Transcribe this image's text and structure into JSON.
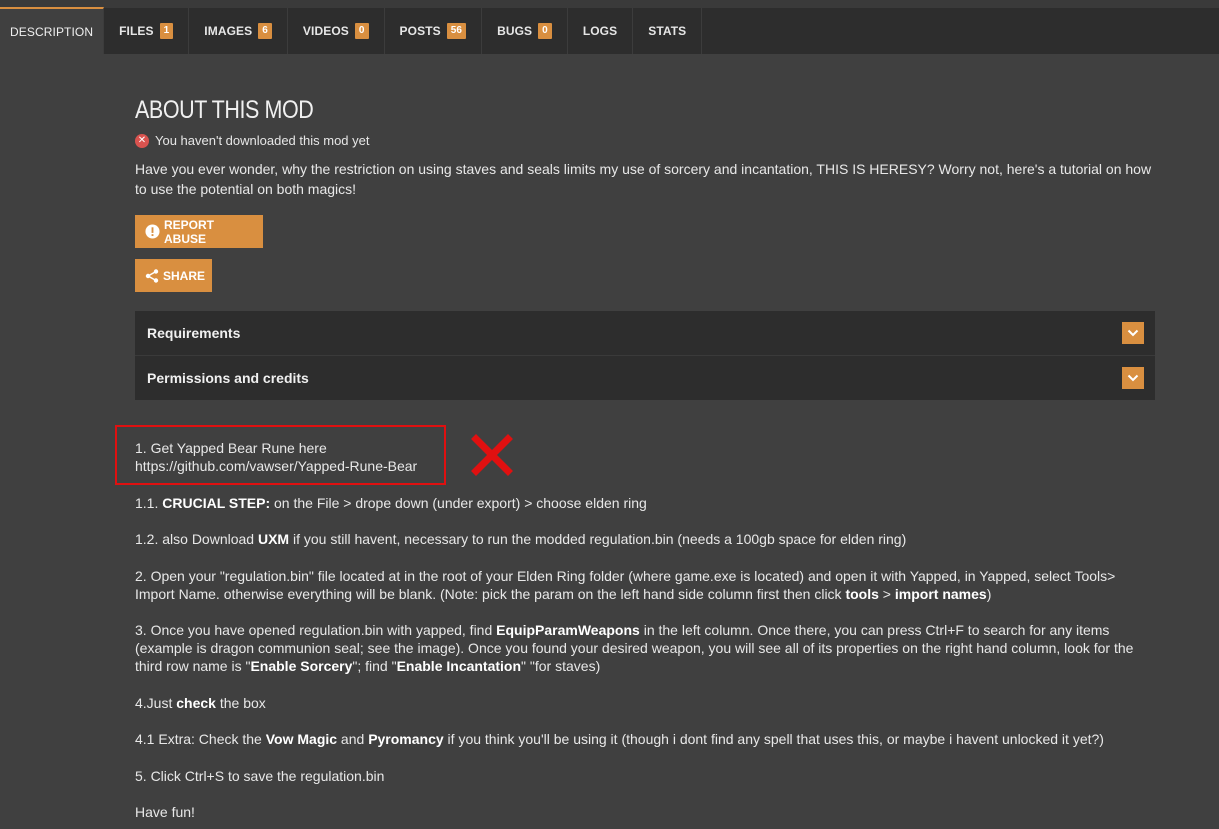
{
  "tabs": [
    {
      "label": "DESCRIPTION",
      "count": null,
      "active": true
    },
    {
      "label": "FILES",
      "count": "1"
    },
    {
      "label": "IMAGES",
      "count": "6"
    },
    {
      "label": "VIDEOS",
      "count": "0"
    },
    {
      "label": "POSTS",
      "count": "56"
    },
    {
      "label": "BUGS",
      "count": "0"
    },
    {
      "label": "LOGS",
      "count": null
    },
    {
      "label": "STATS",
      "count": null
    }
  ],
  "about": {
    "title": "ABOUT THIS MOD",
    "download_status": "You haven't downloaded this mod yet",
    "intro": "Have you ever wonder, why the restriction on using staves and seals limits my use of sorcery and incantation, THIS IS HERESY? Worry not, here's a tutorial on how to use the potential on both magics!"
  },
  "buttons": {
    "report": "REPORT ABUSE",
    "share": "SHARE"
  },
  "accordion": {
    "requirements": "Requirements",
    "permissions": "Permissions and credits"
  },
  "steps": {
    "s1_line1": "1. Get Yapped Bear Rune here",
    "s1_line2": "https://github.com/vawser/Yapped-Rune-Bear",
    "s11_bold": "CRUCIAL STEP:",
    "s11_pre": "1.1. ",
    "s11_post": " on the File > drope down (under export) > choose elden ring",
    "s12_pre": "1.2. also Download ",
    "s12_bold": "UXM",
    "s12_post": " if you still havent, necessary to run the modded regulation.bin (needs a 100gb space for elden ring)",
    "s2_pre": "2. Open your \"regulation.bin\" file located at in the root of your Elden Ring folder (where game.exe is located) and open it with Yapped, in Yapped, select Tools> Import Name. otherwise everything will be blank. (Note: pick the param on the left hand side column first then click ",
    "s2_b1": "tools",
    "s2_mid": " > ",
    "s2_b2": "import names",
    "s2_post": ")",
    "s3_pre": "3. Once you have opened regulation.bin with yapped, find ",
    "s3_b1": "EquipParamWeapons",
    "s3_mid1": " in the left column. Once there, you can press Ctrl+F to search for any items (example is dragon communion seal; see the image). Once you found your desired weapon, you will see all of its properties on the right hand column, look for the third row name is \"",
    "s3_b2": "Enable Sorcery",
    "s3_mid2": "\"; find \"",
    "s3_b3": "Enable Incantation",
    "s3_post": "\" \"for staves)",
    "s4_pre": "4.Just ",
    "s4_bold": "check",
    "s4_post": " the box",
    "s41_pre": "4.1 Extra: Check the ",
    "s41_b1": "Vow Magic",
    "s41_mid": " and ",
    "s41_b2": "Pyromancy",
    "s41_post": " if you think you'll be using it (though i dont find any spell that uses this, or maybe i havent unlocked it yet?)",
    "s5": "5. Click Ctrl+S to save the regulation.bin",
    "outro": "Have fun!"
  },
  "colors": {
    "accent": "#d98f40",
    "background": "#404040",
    "tabbar": "#2d2d2d",
    "annotation_red": "#e01010"
  }
}
